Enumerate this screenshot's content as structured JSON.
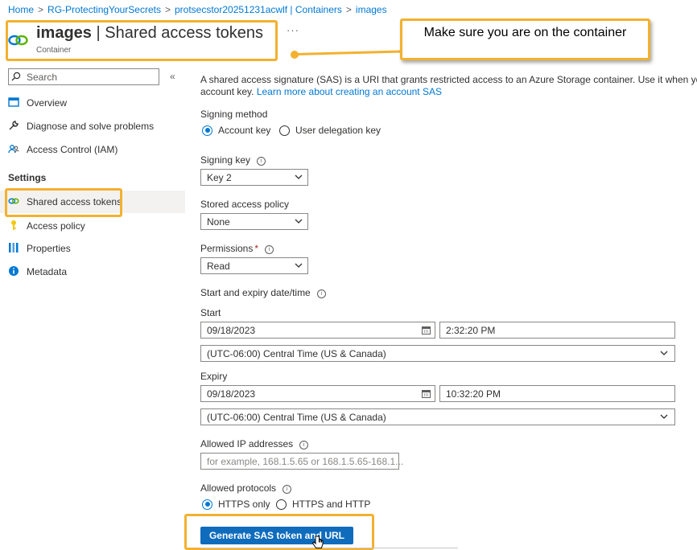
{
  "breadcrumb": [
    "Home",
    "RG-ProtectingYourSecrets",
    "protsecstor20251231acwlf | Containers",
    "images"
  ],
  "header": {
    "title_bold": "images",
    "title_rest": " | Shared access tokens",
    "subtitle": "Container",
    "more": "···"
  },
  "callout": {
    "text": "Make sure you are on the container"
  },
  "sidebar": {
    "search_placeholder": "Search",
    "collapse": "«",
    "items": [
      {
        "label": "Overview",
        "icon": "overview-icon"
      },
      {
        "label": "Diagnose and solve problems",
        "icon": "wrench-icon"
      },
      {
        "label": "Access Control (IAM)",
        "icon": "people-icon"
      }
    ],
    "settings_heading": "Settings",
    "settings_items": [
      {
        "label": "Shared access tokens",
        "icon": "link-icon",
        "active": true
      },
      {
        "label": "Access policy",
        "icon": "key-icon"
      },
      {
        "label": "Properties",
        "icon": "properties-icon"
      },
      {
        "label": "Metadata",
        "icon": "info-icon"
      }
    ]
  },
  "main": {
    "description_line1": "A shared access signature (SAS) is a URI that grants restricted access to an Azure Storage container. Use it when you wa",
    "description_line2_prefix": "account key. ",
    "learn_more": "Learn more about creating an account SAS",
    "signing_method": {
      "label": "Signing method",
      "options": [
        "Account key",
        "User delegation key"
      ],
      "selected": "Account key"
    },
    "signing_key": {
      "label": "Signing key",
      "value": "Key 2"
    },
    "stored_policy": {
      "label": "Stored access policy",
      "value": "None"
    },
    "permissions": {
      "label": "Permissions",
      "required": "*",
      "value": "Read"
    },
    "datetime_label": "Start and expiry date/time",
    "start": {
      "label": "Start",
      "date": "09/18/2023",
      "time": "2:32:20 PM",
      "timezone": "(UTC-06:00) Central Time (US & Canada)"
    },
    "expiry": {
      "label": "Expiry",
      "date": "09/18/2023",
      "time": "10:32:20 PM",
      "timezone": "(UTC-06:00) Central Time (US & Canada)"
    },
    "allowed_ip": {
      "label": "Allowed IP addresses",
      "placeholder": "for example, 168.1.5.65 or 168.1.5.65-168.1..."
    },
    "protocols": {
      "label": "Allowed protocols",
      "options": [
        "HTTPS only",
        "HTTPS and HTTP"
      ],
      "selected": "HTTPS only"
    },
    "generate_button": "Generate SAS token and URL",
    "info_glyph": "i"
  },
  "colors": {
    "accent": "#0078d4",
    "highlight": "#f3b12f",
    "button": "#0f6cbd"
  }
}
